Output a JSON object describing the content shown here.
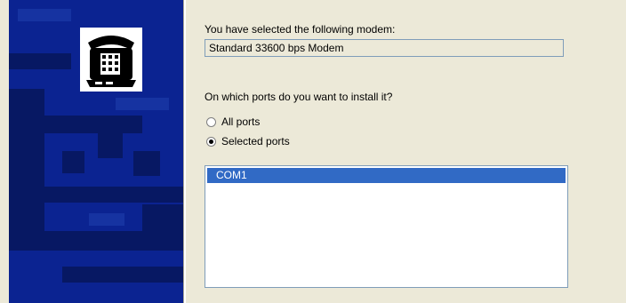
{
  "header": {
    "selected_modem_label": "You have selected the following modem:",
    "selected_modem_value": "Standard 33600 bps Modem",
    "ports_question": "On which ports do you want to install it?"
  },
  "ports_option": {
    "all_ports_label": "All ports",
    "selected_ports_label": "Selected ports",
    "selected": "Selected ports"
  },
  "port_list": {
    "items": [
      "COM1"
    ],
    "selected_item": "COM1"
  },
  "graphic": {
    "icon": "telephone-modem-icon",
    "accent_color": "#0a1f8a",
    "selection_color": "#316ac5"
  }
}
